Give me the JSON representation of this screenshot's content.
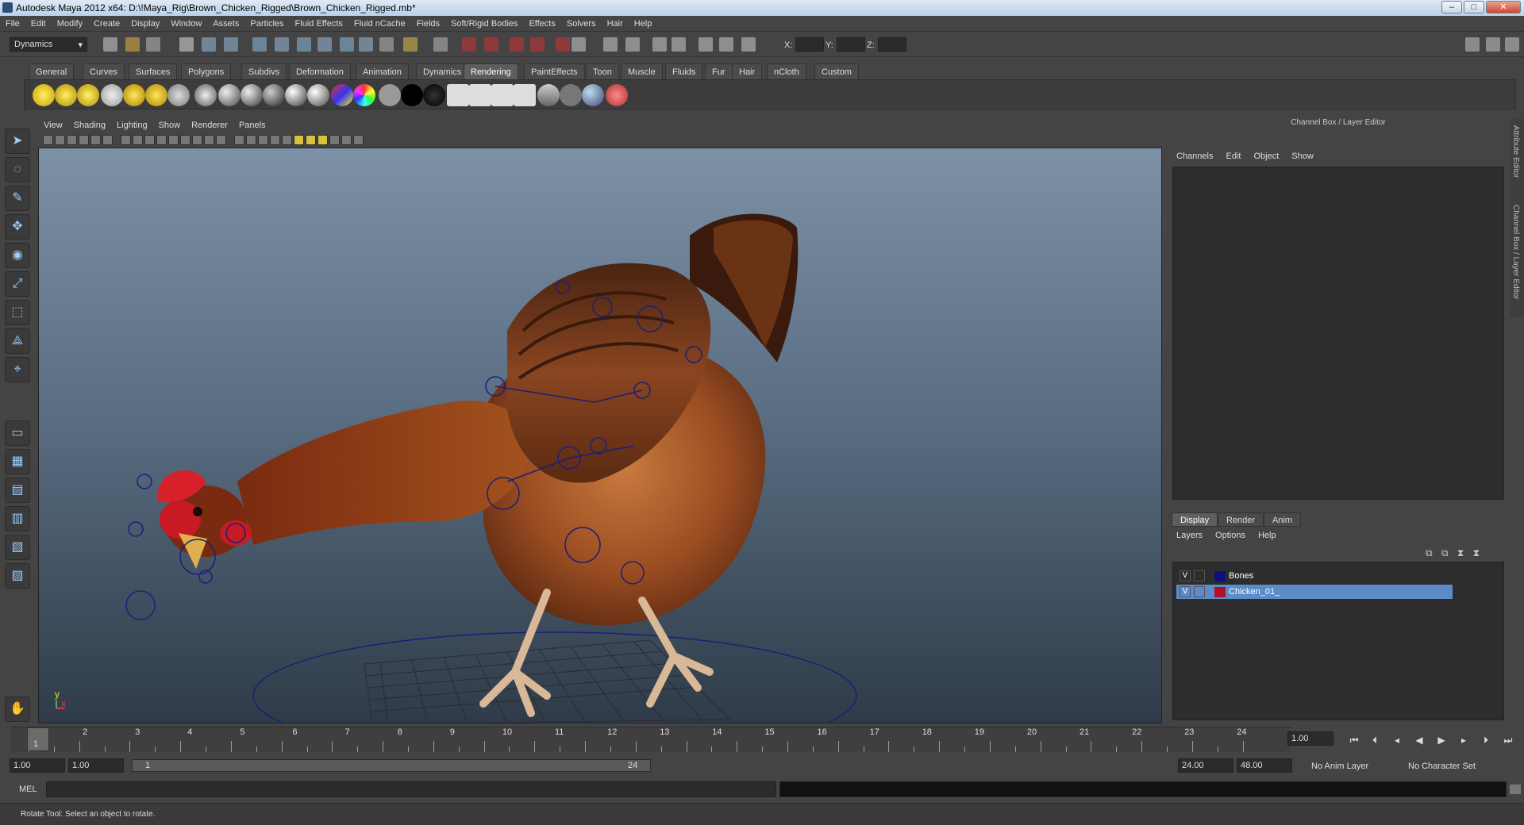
{
  "window": {
    "title": "Autodesk Maya 2012 x64: D:\\!Maya_Rig\\Brown_Chicken_Rigged\\Brown_Chicken_Rigged.mb*"
  },
  "menubar": [
    "File",
    "Edit",
    "Modify",
    "Create",
    "Display",
    "Window",
    "Assets",
    "Particles",
    "Fluid Effects",
    "Fluid nCache",
    "Fields",
    "Soft/Rigid Bodies",
    "Effects",
    "Solvers",
    "Hair",
    "Help"
  ],
  "statusline": {
    "menuset": "Dynamics",
    "x_label": "X:",
    "y_label": "Y:",
    "z_label": "Z:"
  },
  "shelf_tabs": [
    "General",
    "Curves",
    "Surfaces",
    "Polygons",
    "Subdivs",
    "Deformation",
    "Animation",
    "Dynamics",
    "Rendering",
    "PaintEffects",
    "Toon",
    "Muscle",
    "Fluids",
    "Fur",
    "Hair",
    "nCloth",
    "Custom"
  ],
  "shelf_active": "Rendering",
  "viewport": {
    "menu": [
      "View",
      "Shading",
      "Lighting",
      "Show",
      "Renderer",
      "Panels"
    ],
    "axis_y": "y",
    "axis_x": "x"
  },
  "channel_box": {
    "title": "Channel Box / Layer Editor",
    "menu": [
      "Channels",
      "Edit",
      "Object",
      "Show"
    ]
  },
  "layer_editor": {
    "tabs": [
      "Display",
      "Render",
      "Anim"
    ],
    "active_tab": "Display",
    "menu": [
      "Layers",
      "Options",
      "Help"
    ],
    "layers": [
      {
        "visible": "V",
        "name": "Bones",
        "color": "#10107a",
        "selected": false
      },
      {
        "visible": "V",
        "name": "Chicken_01_",
        "color": "#b0102a",
        "selected": true
      }
    ]
  },
  "side_tabs": [
    "Attribute Editor",
    "Channel Box / Layer Editor"
  ],
  "timeline": {
    "ticks": [
      "1",
      "2",
      "3",
      "4",
      "5",
      "6",
      "7",
      "8",
      "9",
      "10",
      "11",
      "12",
      "13",
      "14",
      "15",
      "16",
      "17",
      "18",
      "19",
      "20",
      "21",
      "22",
      "23",
      "24"
    ],
    "current_frame": "1",
    "current_time_field": "1.00"
  },
  "range": {
    "start": "1.00",
    "playback_start": "1.00",
    "range_start_label": "1",
    "range_end_label": "24",
    "playback_end": "24.00",
    "end": "48.00",
    "anim_layer": "No Anim Layer",
    "character_set": "No Character Set"
  },
  "command_line": {
    "label": "MEL"
  },
  "help_line": {
    "text": "Rotate Tool: Select an object to rotate."
  },
  "colors": {
    "accent": "#5b8cc8",
    "viewport_top": "#7c90a6",
    "viewport_bottom": "#2f3b48"
  }
}
